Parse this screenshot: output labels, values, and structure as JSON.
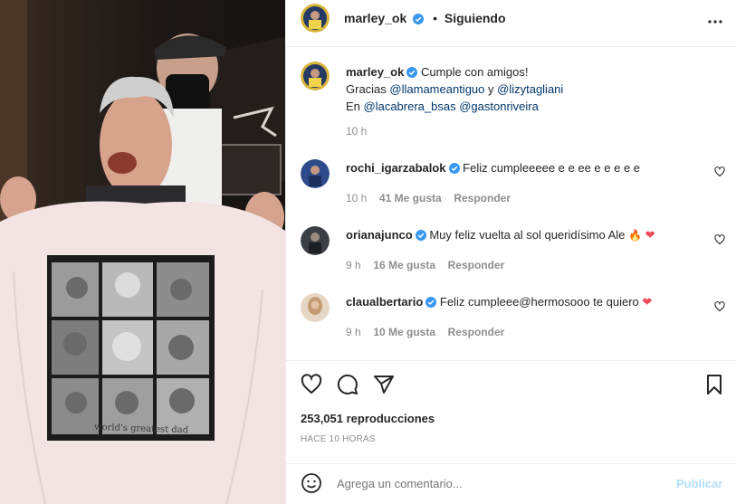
{
  "header": {
    "username": "marley_ok",
    "separator": "•",
    "follow_status": "Siguiendo",
    "more_icon": "more-horizontal-icon"
  },
  "caption": {
    "username": "marley_ok",
    "line1": "Cumple con amigos!",
    "line2_prefix": "Gracias ",
    "mention1": "@llamameantiguo",
    "line2_mid": " y ",
    "mention2": "@lizytagliani",
    "line3_prefix": "En ",
    "mention3": "@lacabrera_bsas",
    "mention4": "@gastonriveira",
    "time": "10 h"
  },
  "comments": [
    {
      "username": "rochi_igarzabalok",
      "text": "Feliz cumpleeeee e e ee e e e e e",
      "time": "10 h",
      "likes": "41 Me gusta",
      "reply": "Responder"
    },
    {
      "username": "orianajunco",
      "text": "Muy feliz vuelta al sol queridísimo Ale",
      "emojis": "🔥",
      "heart": "❤",
      "time": "9 h",
      "likes": "16 Me gusta",
      "reply": "Responder"
    },
    {
      "username": "claualbertario",
      "text": "Feliz cumpleee@hermosooo te quiero",
      "heart": "❤",
      "time": "9 h",
      "likes": "10 Me gusta",
      "reply": "Responder"
    }
  ],
  "actions": {
    "views": "253,051 reproducciones",
    "date": "HACE 10 HORAS"
  },
  "comment_box": {
    "placeholder": "Agrega un comentario...",
    "publish": "Publicar"
  },
  "shirt_text": "world's greatest dad",
  "colors": {
    "verified": "#3897f0",
    "link": "#00376b",
    "muted": "#8e8e8e",
    "publish_disabled": "#b2dffc",
    "heart_red": "#ed4956"
  }
}
